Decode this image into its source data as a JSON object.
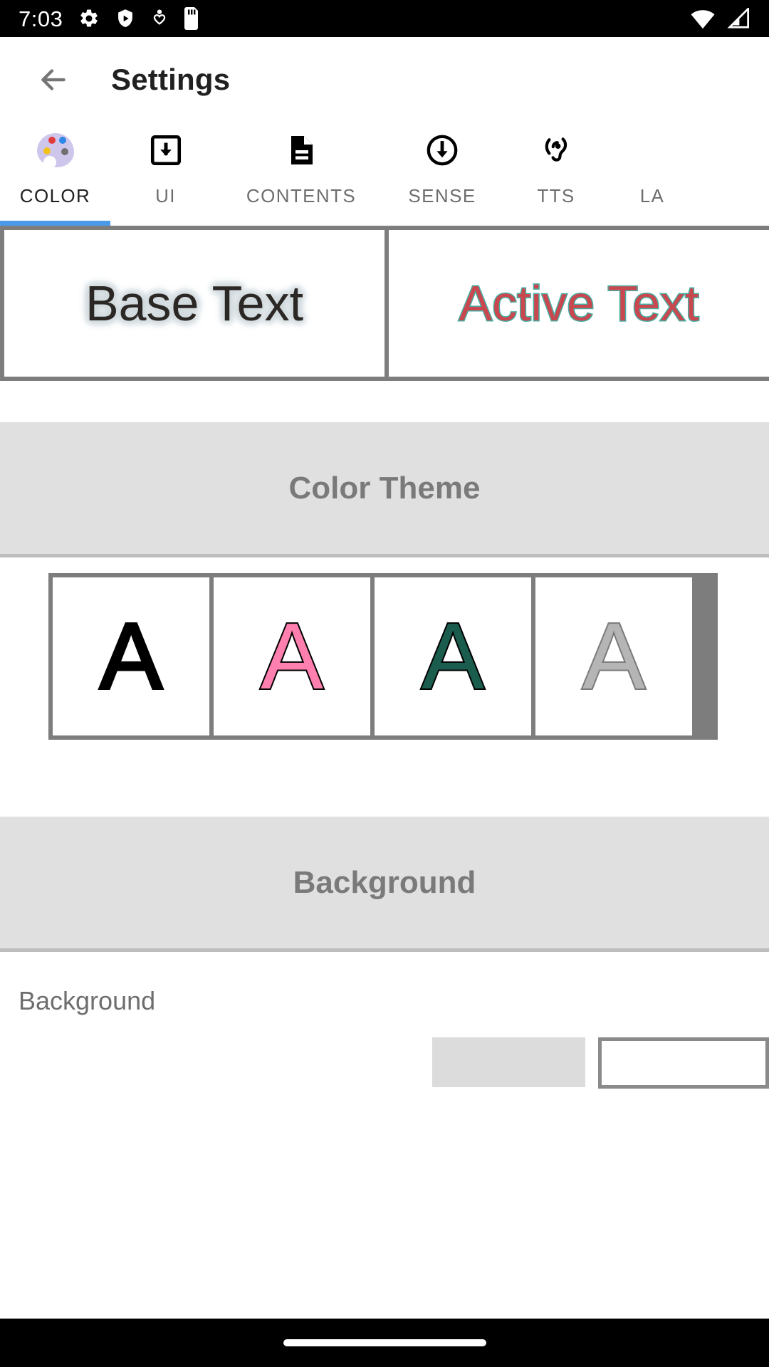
{
  "status_bar": {
    "time": "7:03",
    "left_icons": [
      "gear-icon",
      "shield-play-icon",
      "person-heart-icon",
      "sd-card-icon"
    ],
    "right_icons": [
      "wifi-icon",
      "cell-signal-icon"
    ]
  },
  "app_bar": {
    "back_icon": "arrow-left-icon",
    "title": "Settings"
  },
  "tabs": [
    {
      "label": "COLOR",
      "icon": "palette-icon",
      "active": true
    },
    {
      "label": "UI",
      "icon": "download-box-icon",
      "active": false
    },
    {
      "label": "CONTENTS",
      "icon": "document-icon",
      "active": false
    },
    {
      "label": "SENSE",
      "icon": "circle-download-icon",
      "active": false
    },
    {
      "label": "TTS",
      "icon": "ear-hearing-icon",
      "active": false
    },
    {
      "label": "LA",
      "icon": "",
      "active": false
    }
  ],
  "preview": {
    "base_text": "Base Text",
    "base_text_color": "#2b2724",
    "base_halo_color": "#cfd8dc",
    "active_text": "Active Text",
    "active_text_color": "#c9474f",
    "active_outline_color": "#45b0a4"
  },
  "sections": {
    "color_theme": {
      "title": "Color Theme",
      "swatches": [
        {
          "letter": "A",
          "fill": "#000000",
          "stroke": "#000000"
        },
        {
          "letter": "A",
          "fill": "#ff7fae",
          "stroke": "#000000"
        },
        {
          "letter": "A",
          "fill": "#1a5c4d",
          "stroke": "#000000"
        },
        {
          "letter": "A",
          "fill": "#b5b5b5",
          "stroke": "#7a7a7a"
        }
      ]
    },
    "background": {
      "title": "Background",
      "row_label": "Background",
      "swatch_grey": "#dcdcdc",
      "swatch_white": "#ffffff"
    }
  },
  "accent_color": "#4a9ae8",
  "nav_bar": {
    "pill": "home-indicator"
  }
}
